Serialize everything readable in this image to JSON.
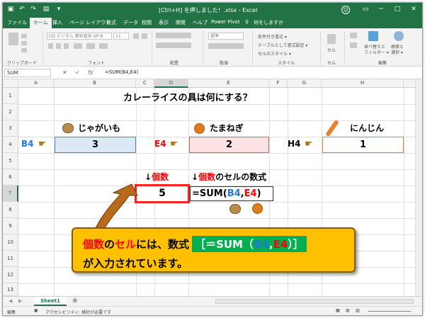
{
  "titlebar": {
    "title": "[Ctrl+H] を押しました！.xlsx  -  Excel",
    "qa_icons": [
      "save-icon",
      "undo-icon",
      "redo-icon",
      "open-icon",
      "customize-icon"
    ],
    "window_buttons": [
      "restore-ribbon-icon",
      "minimize-icon",
      "maximize-icon",
      "close-icon"
    ]
  },
  "tabs": [
    "ファイル",
    "ホーム",
    "挿入",
    "ページ レイアウト",
    "数式",
    "データ",
    "校閲",
    "表示",
    "開発",
    "ヘルプ",
    "Power Pivot"
  ],
  "tell_me": "何をしますか",
  "ribbon": {
    "groups": [
      "クリップボード",
      "フォント",
      "配置",
      "数値",
      "スタイル",
      "セル",
      "編集"
    ],
    "font_name": "UD デジタル 教科書体 NP-B",
    "font_size": "11",
    "number_format": "標準",
    "style_items": [
      "条件付き書式 ▾",
      "テーブルとして書式設定 ▾",
      "セルのスタイル ▾"
    ],
    "cell_label": "セル",
    "edit_items": [
      "並べ替えと",
      "フィルター ▾",
      "検索と",
      "選択 ▾"
    ]
  },
  "formula_bar": {
    "name_box": "SUM",
    "fx": "fx",
    "formula": "=SUM(B4,E4)"
  },
  "columns": [
    "A",
    "B",
    "C",
    "D",
    "E",
    "F",
    "G",
    "H"
  ],
  "rows": [
    "1",
    "2",
    "3",
    "4",
    "5",
    "6",
    "7",
    "8",
    "9",
    "10",
    "11",
    "12",
    "13"
  ],
  "sheet": {
    "title": "カレーライスの具は何にする？",
    "item_b": "じゃがいも",
    "item_e": "たまねぎ",
    "item_h": "にんじん",
    "ref_b": "B4",
    "ref_e": "E4",
    "ref_h": "H4",
    "val_b": "3",
    "val_e": "2",
    "val_h": "1",
    "note_arrow1": "↓",
    "note_count": "個数",
    "note_arrow2": "↓",
    "note_count2": "個数",
    "note_rest": "のセルの数式",
    "result": "5",
    "formula_pre": "=SUM(",
    "formula_b": "B4",
    "formula_sep": ",",
    "formula_e": "E4",
    "formula_post": ")"
  },
  "callout": {
    "p1": "個数",
    "p2": "の",
    "p3": "セル",
    "p4": "には、数式",
    "f_open": "［＝SUM（",
    "f_b": "B4",
    "f_sep": ",",
    "f_e": "E4",
    "f_close": "）］",
    "line2": "が入力されています。"
  },
  "sheet_tab": "Sheet1",
  "status": {
    "mode": "編集",
    "accessibility": "アクセシビリティ: 検討が必要です"
  },
  "colors": {
    "excel_green": "#217346",
    "blue_cell_bg": "#dde8f6",
    "blue_border": "#4a86c6",
    "red_cell_bg": "#fbe3e3",
    "red_border": "#e05a5a",
    "orange_border": "#ed7d31",
    "callout_bg": "#ffc000",
    "formula_green": "#00b050"
  }
}
